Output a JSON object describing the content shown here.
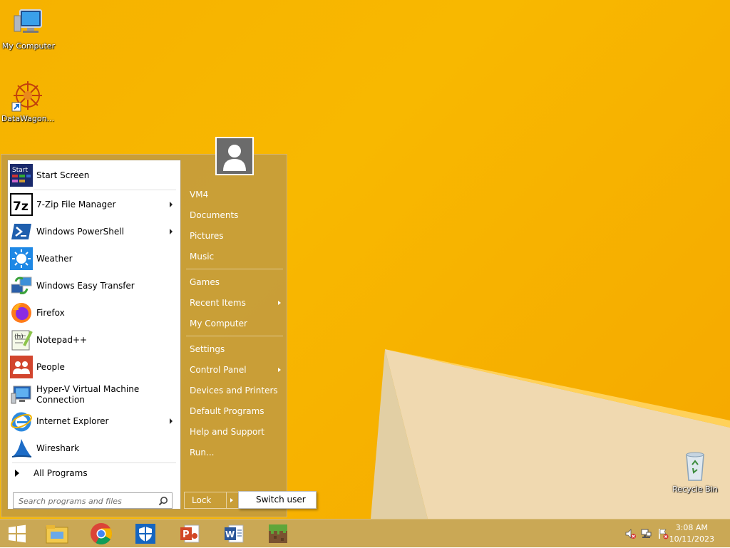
{
  "desktop": {
    "icons": [
      {
        "label": "My Computer"
      },
      {
        "label": "DataWagon..."
      },
      {
        "label": "Recycle Bin"
      }
    ]
  },
  "start_menu": {
    "left_items": [
      {
        "label": "Start Screen",
        "icon": "start-screen-icon",
        "submenu": false
      },
      {
        "label": "7-Zip File Manager",
        "icon": "7zip-icon",
        "submenu": true
      },
      {
        "label": "Windows PowerShell",
        "icon": "powershell-icon",
        "submenu": true
      },
      {
        "label": "Weather",
        "icon": "weather-icon",
        "submenu": false
      },
      {
        "label": "Windows Easy Transfer",
        "icon": "easy-transfer-icon",
        "submenu": false
      },
      {
        "label": "Firefox",
        "icon": "firefox-icon",
        "submenu": false
      },
      {
        "label": "Notepad++",
        "icon": "notepadpp-icon",
        "submenu": false
      },
      {
        "label": "People",
        "icon": "people-icon",
        "submenu": false
      },
      {
        "label": "Hyper-V Virtual Machine",
        "label2": "Connection",
        "icon": "hyperv-icon",
        "submenu": false
      },
      {
        "label": "Internet Explorer",
        "icon": "ie-icon",
        "submenu": true
      },
      {
        "label": "Wireshark",
        "icon": "wireshark-icon",
        "submenu": false
      }
    ],
    "all_programs": "All Programs",
    "search_placeholder": "Search programs and files",
    "right_items": [
      {
        "label": "VM4"
      },
      {
        "label": "Documents"
      },
      {
        "label": "Pictures"
      },
      {
        "label": "Music"
      },
      {
        "label": "Games"
      },
      {
        "label": "Recent Items",
        "submenu": true
      },
      {
        "label": "My Computer"
      },
      {
        "label": "Settings"
      },
      {
        "label": "Control Panel",
        "submenu": true
      },
      {
        "label": "Devices and Printers"
      },
      {
        "label": "Default Programs"
      },
      {
        "label": "Help and Support"
      },
      {
        "label": "Run..."
      }
    ],
    "lock_label": "Lock",
    "switch_user_label": "Switch user"
  },
  "taskbar": {
    "pinned": [
      "start-button",
      "file-explorer-icon",
      "chrome-icon",
      "defender-icon",
      "powerpoint-icon",
      "word-icon",
      "minecraft-icon"
    ],
    "clock": {
      "time": "3:08 AM",
      "date": "10/11/2023"
    }
  },
  "colors": {
    "wallpaper": "#f7b200",
    "menu": "#c49c3c",
    "taskbar": "#c8a550"
  }
}
